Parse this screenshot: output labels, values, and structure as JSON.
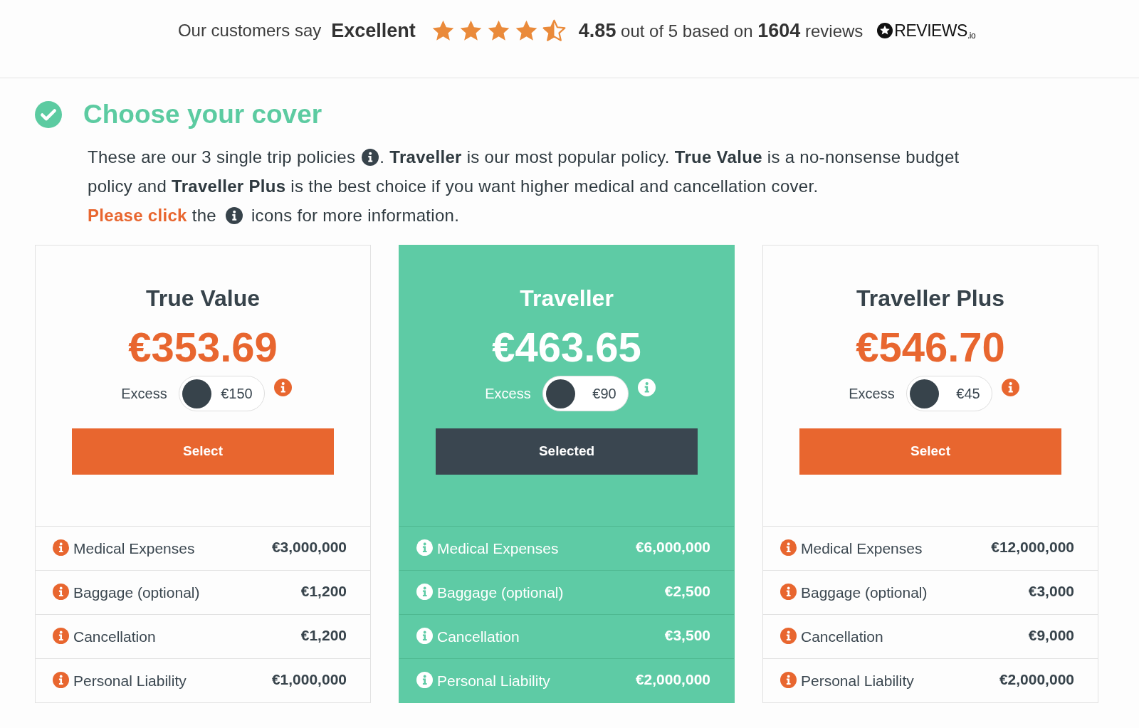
{
  "review_bar": {
    "lead": "Our customers say",
    "verdict": "Excellent",
    "stars": 4.5,
    "summary": "**4.85** out of 5 based on **1604** reviews",
    "logo": "REVIEWS$_{.io}$"
  },
  "section": {
    "done": true,
    "title": "Choose your cover",
    "intro": {
      "part_1": "These are our 3 single trip policies",
      "part_2": ". **Traveller** is our most popular policy. **True Value** is a no-nonsense budget",
      "part_3": "policy and **Traveller Plus** is the best choice if you want higher medical and cancellation cover.",
      "highlight": "Please click",
      "part_4": "the",
      "part_5": "icons for more information."
    }
  },
  "policies": [
    {
      "name": "True Value",
      "price": "€353.69",
      "excess_label": "Excess",
      "excess": "€150",
      "button": "Select",
      "selected": false,
      "cover": [
        {
          "label": "Medical Expenses",
          "value": "€3,000,000"
        },
        {
          "label": "Baggage (optional)",
          "value": "€1,200"
        },
        {
          "label": "Cancellation",
          "value": "€1,200"
        },
        {
          "label": "Personal Liability",
          "value": "€1,000,000"
        }
      ]
    },
    {
      "name": "Traveller",
      "price": "€463.65",
      "excess_label": "Excess",
      "excess": "€90",
      "button": "Selected",
      "selected": true,
      "cover": [
        {
          "label": "Medical Expenses",
          "value": "€6,000,000"
        },
        {
          "label": "Baggage (optional)",
          "value": "€2,500"
        },
        {
          "label": "Cancellation",
          "value": "€3,500"
        },
        {
          "label": "Personal Liability",
          "value": "€2,000,000"
        }
      ]
    },
    {
      "name": "Traveller Plus",
      "price": "€546.70",
      "excess_label": "Excess",
      "excess": "€45",
      "button": "Select",
      "selected": false,
      "cover": [
        {
          "label": "Medical Expenses",
          "value": "€12,000,000"
        },
        {
          "label": "Baggage (optional)",
          "value": "€3,000"
        },
        {
          "label": "Cancellation",
          "value": "€9,000"
        },
        {
          "label": "Personal Liability",
          "value": "€2,000,000"
        }
      ]
    }
  ]
}
